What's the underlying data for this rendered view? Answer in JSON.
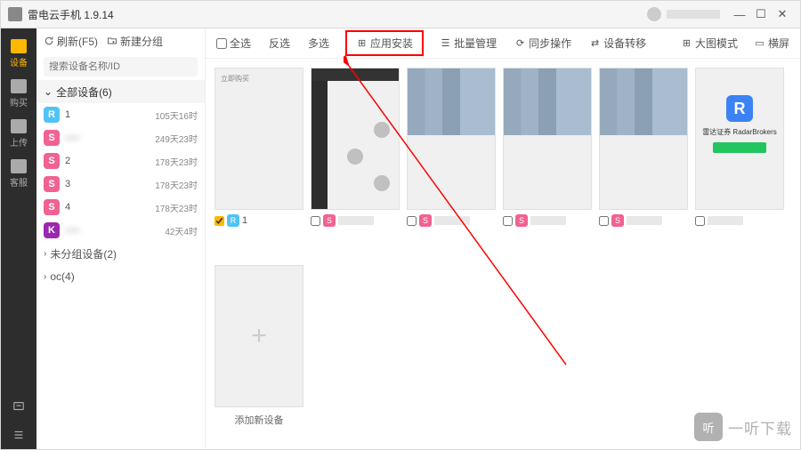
{
  "app": {
    "title": "雷电云手机 1.9.14"
  },
  "win": {
    "min": "—",
    "max": "☐",
    "close": "✕"
  },
  "nav": {
    "items": [
      {
        "label": "设备"
      },
      {
        "label": "购买"
      },
      {
        "label": "上传"
      },
      {
        "label": "客服"
      }
    ]
  },
  "panel": {
    "refresh": "刷新(F5)",
    "newGroup": "新建分组",
    "searchPlaceholder": "搜索设备名称/ID",
    "allDevices": "全部设备(6)",
    "devices": [
      {
        "icon": "R",
        "cls": "blue",
        "name": "1",
        "time": "105天16时",
        "blur": false
      },
      {
        "icon": "S",
        "cls": "pink",
        "name": "xxx",
        "time": "249天23时",
        "blur": true
      },
      {
        "icon": "S",
        "cls": "pink",
        "name": "2",
        "time": "178天23时",
        "blur": false
      },
      {
        "icon": "S",
        "cls": "pink",
        "name": "3",
        "time": "178天23时",
        "blur": false
      },
      {
        "icon": "S",
        "cls": "pink",
        "name": "4",
        "time": "178天23时",
        "blur": false
      },
      {
        "icon": "K",
        "cls": "purple",
        "name": "xxx",
        "time": "42天4时",
        "blur": true
      }
    ],
    "ungrouped": "未分组设备(2)",
    "oc": "oc(4)"
  },
  "toolbar": {
    "selectAll": "全选",
    "invert": "反选",
    "multi": "多选",
    "appInstall": "应用安装",
    "batch": "批量管理",
    "sync": "同步操作",
    "transfer": "设备转移",
    "bigMode": "大图模式",
    "landscape": "横屏"
  },
  "tiles": {
    "t1": {
      "name": "1"
    },
    "radar": "雷达证券 RadarBrokers",
    "addNew": "添加新设备",
    "btn": "立即购买"
  },
  "watermark": {
    "icon": "听",
    "text": "一听下载"
  }
}
